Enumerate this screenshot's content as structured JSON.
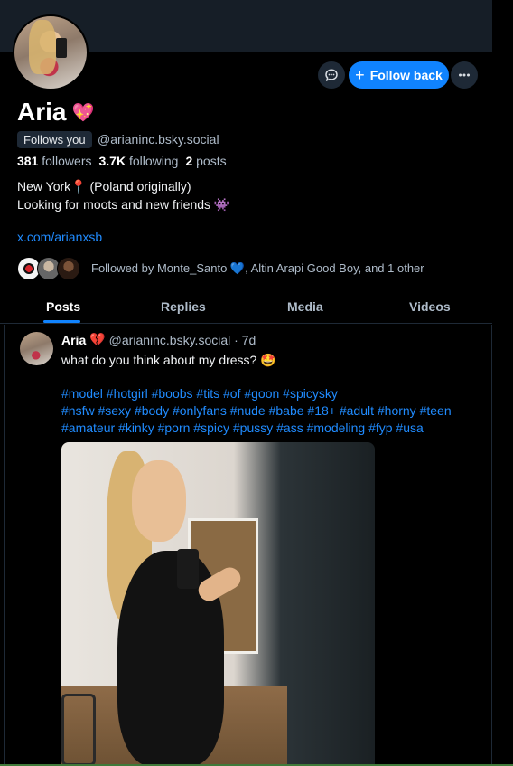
{
  "profile": {
    "display_name": "Aria",
    "name_emoji": "💖",
    "follows_you_label": "Follows you",
    "handle": "@arianinc.bsky.social",
    "followers_count": "381",
    "followers_label": "followers",
    "following_count": "3.7K",
    "following_label": "following",
    "posts_count": "2",
    "posts_label": "posts",
    "bio_line1": "New York📍 (Poland originally)",
    "bio_line2": "Looking for moots and new friends 👾",
    "link": "x.com/arianxsb",
    "followed_by": "Followed by Monte_Santo 💙, Altin Arapi Good Boy, and 1 other"
  },
  "actions": {
    "chat_icon": "chat-bubble-icon",
    "follow_back_label": "Follow back",
    "more_icon": "ellipsis-icon"
  },
  "tabs": [
    {
      "label": "Posts",
      "active": true
    },
    {
      "label": "Replies",
      "active": false
    },
    {
      "label": "Media",
      "active": false
    },
    {
      "label": "Videos",
      "active": false
    }
  ],
  "post": {
    "author_name": "Aria",
    "author_emoji": "💔",
    "handle_time": "@arianinc.bsky.social · 7d",
    "text": "what do you think about my dress? 🤩",
    "hashtags_line1": "#model #hotgirl #boobs #tits #of #goon #spicysky",
    "hashtags_line2": "#nsfw #sexy #body #onlyfans #nude #babe #18+ #adult #horny #teen",
    "hashtags_line3": "#amateur #kinky #porn #spicy #pussy #ass #modeling #fyp #usa"
  },
  "colors": {
    "background": "#000000",
    "accent": "#1083fe",
    "link": "#208bfe",
    "muted_text": "#aebbc9",
    "button_bg": "#1e2936"
  }
}
